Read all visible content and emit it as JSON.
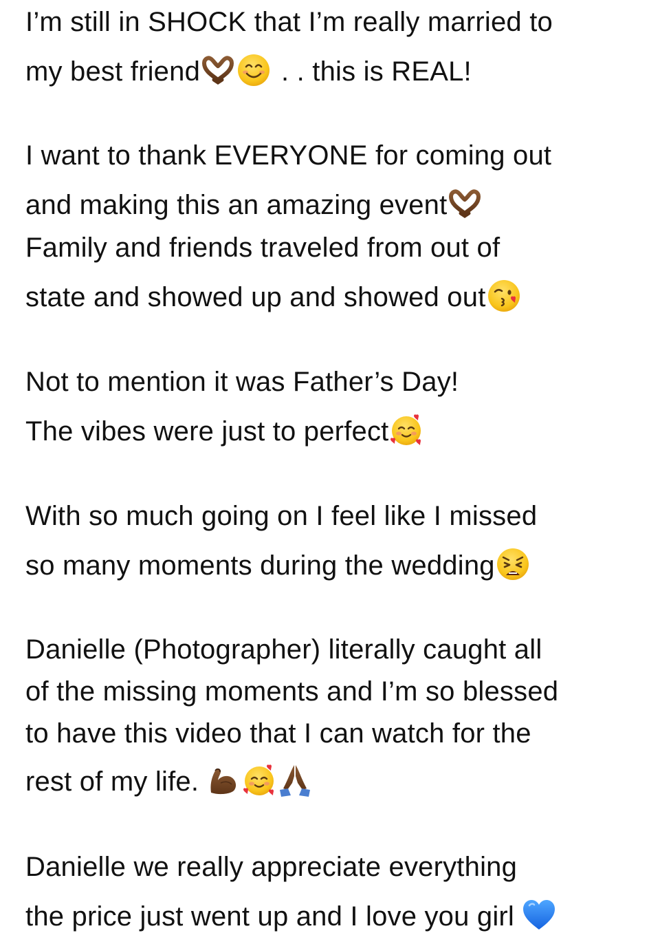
{
  "post": {
    "p1": {
      "l1": "I’m still in SHOCK that I’m really married to",
      "l2a": "my best friend",
      "l2b": ". . this is REAL!"
    },
    "p2": {
      "l1": "I want to thank EVERYONE for coming out",
      "l2": "and making this an amazing event",
      "l3": "Family and friends traveled from out of",
      "l4": "state and showed up and showed out"
    },
    "p3": {
      "l1": "Not to mention it was Father’s Day!",
      "l2": "The vibes were just to perfect"
    },
    "p4": {
      "l1": "With so much going on I feel like I missed",
      "l2": "so many moments during the wedding"
    },
    "p5": {
      "l1": "Danielle (Photographer) literally caught all",
      "l2": "of the missing moments and I’m so blessed",
      "l3": "to have this video that I can watch for the",
      "l4": "rest of my life."
    },
    "p6": {
      "l1": "Danielle we really appreciate everything",
      "l2": "the price just went up and I love you girl"
    }
  },
  "emoji_names": [
    "heart-hands-emoji",
    "smiling-face-emoji",
    "face-blowing-kiss-emoji",
    "smiling-face-with-hearts-emoji",
    "weary-face-emoji",
    "flexed-biceps-emoji",
    "folded-hands-emoji",
    "blue-heart-emoji"
  ],
  "colors": {
    "text": "#111111",
    "background": "#ffffff",
    "skin_tone": "#7a4a28",
    "emoji_yellow": "#f9c51c",
    "blue_heart": "#1e7cf2"
  }
}
